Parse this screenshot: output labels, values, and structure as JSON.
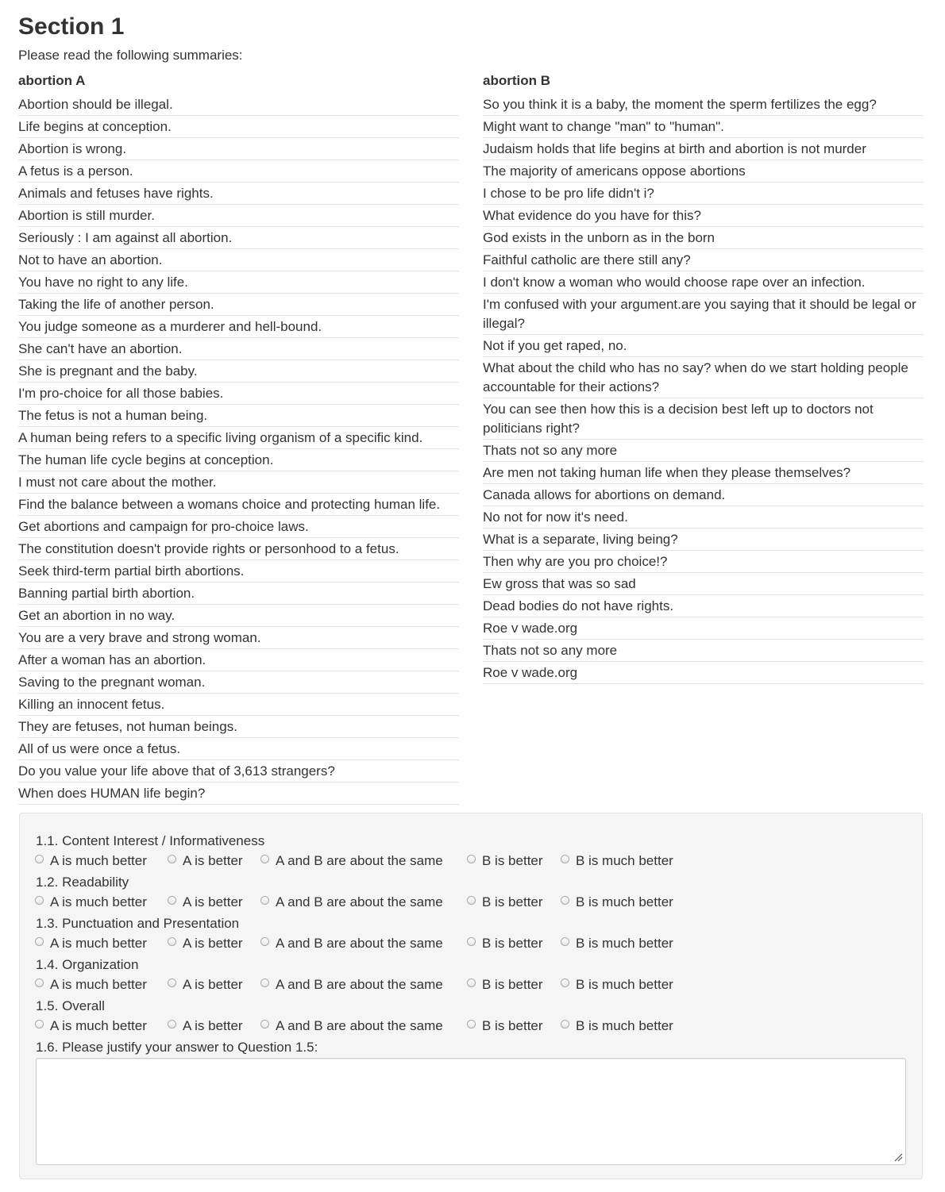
{
  "section": {
    "title": "Section 1",
    "intro": "Please read the following summaries:"
  },
  "summaries": {
    "a": {
      "heading": "abortion A",
      "items": [
        "Abortion should be illegal.",
        "Life begins at conception.",
        "Abortion is wrong.",
        "A fetus is a person.",
        "Animals and fetuses have rights.",
        "Abortion is still murder.",
        "Seriously : I am against all abortion.",
        "Not to have an abortion.",
        "You have no right to any life.",
        "Taking the life of another person.",
        "You judge someone as a murderer and hell-bound.",
        "She can't have an abortion.",
        "She is pregnant and the baby.",
        "I'm pro-choice for all those babies.",
        "The fetus is not a human being.",
        "A human being refers to a specific living organism of a specific kind.",
        "The human life cycle begins at conception.",
        "I must not care about the mother.",
        "Find the balance between a womans choice and protecting human life.",
        "Get abortions and campaign for pro-choice laws.",
        "The constitution doesn't provide rights or personhood to a fetus.",
        "Seek third-term partial birth abortions.",
        "Banning partial birth abortion.",
        "Get an abortion in no way.",
        "You are a very brave and strong woman.",
        "After a woman has an abortion.",
        "Saving to the pregnant woman.",
        "Killing an innocent fetus.",
        "They are fetuses, not human beings.",
        "All of us were once a fetus.",
        "Do you value your life above that of 3,613 strangers?",
        "When does HUMAN life begin?"
      ]
    },
    "b": {
      "heading": "abortion B",
      "items": [
        "So you think it is a baby, the moment the sperm fertilizes the egg?",
        "Might want to change \"man\" to \"human\".",
        "Judaism holds that life begins at birth and abortion is not murder",
        "The majority of americans oppose abortions",
        "I chose to be pro life didn't i?",
        "What evidence do you have for this?",
        "God exists in the unborn as in the born",
        "Faithful catholic are there still any?",
        "I don't know a woman who would choose rape over an infection.",
        "I'm confused with your argument.are you saying that it should be legal or illegal?",
        "Not if you get raped, no.",
        "What about the child who has no say? when do we start holding people accountable for their actions?",
        "You can see then how this is a decision best left up to doctors not politicians right?",
        "Thats not so any more",
        "Are men not taking human life when they please themselves?",
        "Canada allows for abortions on demand.",
        "No not for now it's need.",
        "What is a separate, living being?",
        "Then why are you pro choice!?",
        "Ew gross that was so sad",
        "Dead bodies do not have rights.",
        "Roe v wade.org",
        "Thats not so any more",
        "Roe v wade.org"
      ]
    }
  },
  "questions": [
    {
      "label": "1.1. Content Interest / Informativeness"
    },
    {
      "label": "1.2. Readability"
    },
    {
      "label": "1.3. Punctuation and Presentation"
    },
    {
      "label": "1.4. Organization"
    },
    {
      "label": "1.5. Overall"
    }
  ],
  "options": [
    "A is much better",
    "A is better",
    "A and B are about the same",
    "B is better",
    "B is much better"
  ],
  "justify": {
    "label": "1.6. Please justify your answer to Question 1.5:",
    "value": ""
  }
}
